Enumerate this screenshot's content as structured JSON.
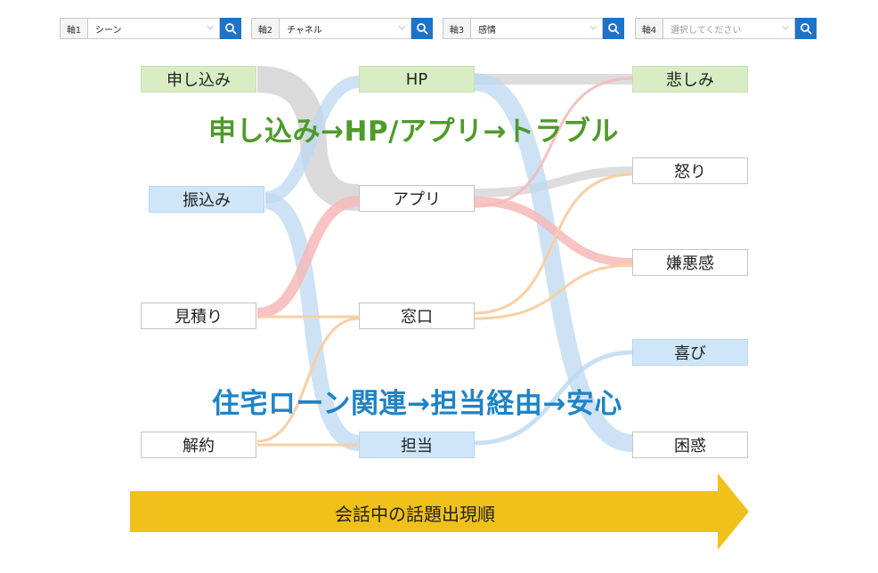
{
  "filters": [
    {
      "label": "軸1",
      "value": "シーン",
      "placeholder": false
    },
    {
      "label": "軸2",
      "value": "チャネル",
      "placeholder": false
    },
    {
      "label": "軸3",
      "value": "感情",
      "placeholder": false
    },
    {
      "label": "軸4",
      "value": "選択してください",
      "placeholder": true
    }
  ],
  "icons": {
    "search": "search-icon",
    "dropdown": "chevron-down-icon"
  },
  "nodes": {
    "scene": [
      "申し込み",
      "振込み",
      "見積り",
      "解約"
    ],
    "channel": [
      "HP",
      "アプリ",
      "窓口",
      "担当"
    ],
    "emotion": [
      "悲しみ",
      "怒り",
      "嫌悪感",
      "喜び",
      "困惑"
    ]
  },
  "headlines": {
    "green": "申し込み→HP/アプリ→トラブル",
    "blue": "住宅ローン関連→担当経由→安心"
  },
  "arrow_label": "会話中の話題出現順",
  "colors": {
    "green_text": "#4e9a2b",
    "blue_text": "#1e84c6",
    "green_node": "#d9edc4",
    "blue_node": "#cfe6f8",
    "arrow": "#f0c11a",
    "search_button": "#1e73c8",
    "flow_gray": "#d4d4d4",
    "flow_blue": "#bcd8f0",
    "flow_red": "#f6b9b9",
    "flow_orange": "#f8cfa3"
  }
}
